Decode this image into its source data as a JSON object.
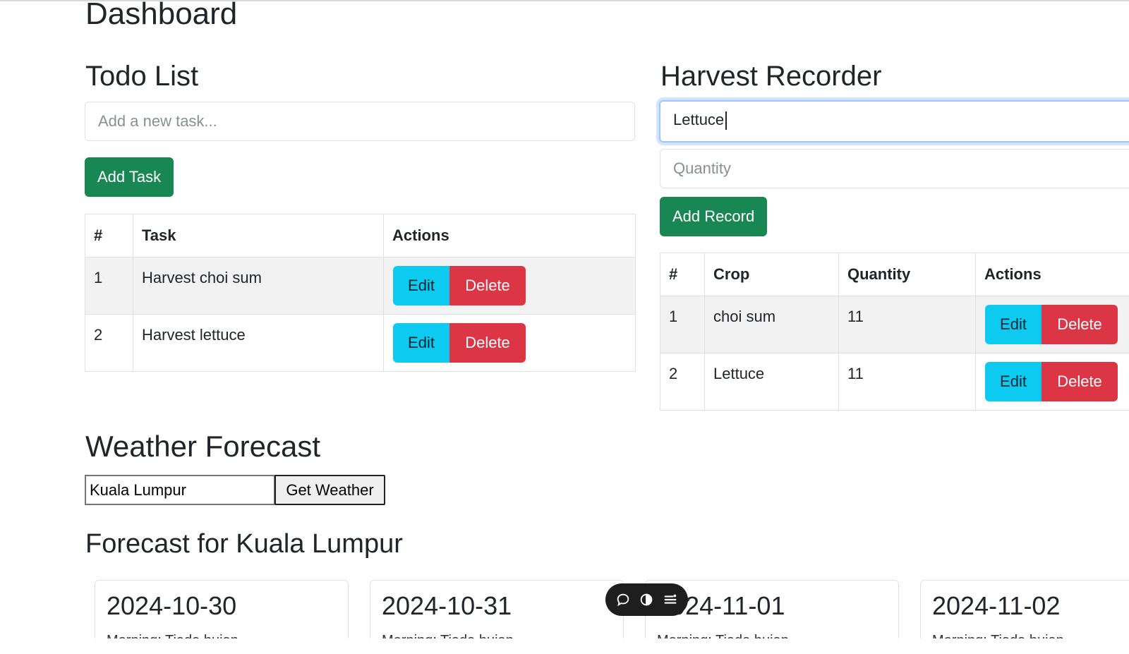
{
  "page": {
    "title": "Dashboard"
  },
  "todo": {
    "title": "Todo List",
    "input_placeholder": "Add a new task...",
    "add_button": "Add Task",
    "columns": [
      "#",
      "Task",
      "Actions"
    ],
    "rows": [
      {
        "num": "1",
        "task": "Harvest choi sum",
        "edit": "Edit",
        "delete": "Delete"
      },
      {
        "num": "2",
        "task": "Harvest lettuce",
        "edit": "Edit",
        "delete": "Delete"
      }
    ]
  },
  "harvest": {
    "title": "Harvest Recorder",
    "crop_value": "Lettuce",
    "quantity_placeholder": "Quantity",
    "add_button": "Add Record",
    "columns": [
      "#",
      "Crop",
      "Quantity",
      "Actions"
    ],
    "rows": [
      {
        "num": "1",
        "crop": "choi sum",
        "quantity": "11",
        "edit": "Edit",
        "delete": "Delete"
      },
      {
        "num": "2",
        "crop": "Lettuce",
        "quantity": "11",
        "edit": "Edit",
        "delete": "Delete"
      }
    ]
  },
  "weather": {
    "title": "Weather Forecast",
    "city_value": "Kuala Lumpur",
    "get_button": "Get Weather",
    "forecast_title": "Forecast for Kuala Lumpur",
    "cards": [
      {
        "date": "2024-10-30",
        "morning": "Morning: Tiada hujan"
      },
      {
        "date": "2024-10-31",
        "morning": "Morning: Tiada hujan"
      },
      {
        "date": "2024-11-01",
        "morning": "Morning: Tiada hujan"
      },
      {
        "date": "2024-11-02",
        "morning": "Morning: Tiada hujan"
      }
    ]
  },
  "overlay_toolbar": {
    "icons": [
      "comment-icon",
      "toggle-icon",
      "menu-icon"
    ]
  },
  "colors": {
    "success": "#198754",
    "info": "#0dcaf0",
    "danger": "#dc3545",
    "focus_border": "#9ec5fe"
  }
}
